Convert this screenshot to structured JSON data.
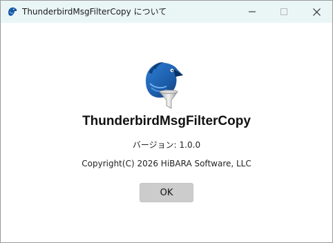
{
  "window": {
    "title": "ThunderbirdMsgFilterCopy について",
    "controls": {
      "minimize_icon": "minimize-icon",
      "maximize_icon": "maximize-icon",
      "close_icon": "close-icon"
    }
  },
  "about": {
    "app_name": "ThunderbirdMsgFilterCopy",
    "version": "バージョン: 1.0.0",
    "copyright": "Copyright(C) 2026 HiBARA Software, LLC",
    "logo_icon": "bird-filter-logo-icon"
  },
  "buttons": {
    "ok_label": "OK"
  },
  "colors": {
    "titlebar_bg": "#eaf6f6",
    "brand_blue": "#1b5aa6",
    "button_bg": "#cccccc"
  }
}
